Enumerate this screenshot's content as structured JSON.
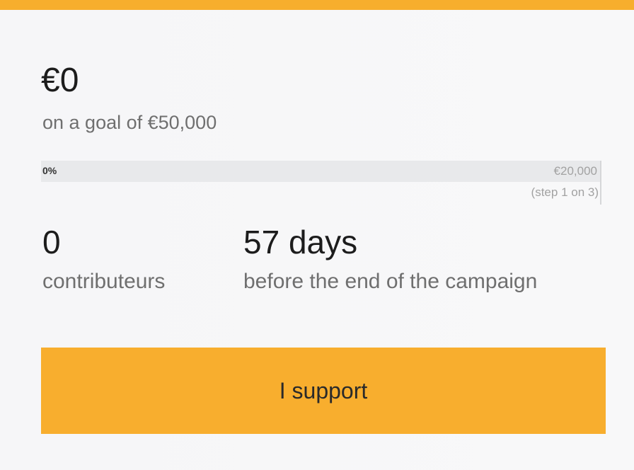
{
  "campaign": {
    "amount_raised": "€0",
    "goal_text": "on a goal of €50,000",
    "progress": {
      "percent_label": "0%",
      "fraction": 0,
      "step_target": "€20,000",
      "step_note": "(step 1 on 3)"
    },
    "stats": [
      {
        "value": "0",
        "label": "contributeurs"
      },
      {
        "value": "57 days",
        "label": "before the end of the campaign"
      }
    ],
    "support_button_label": "I support"
  },
  "colors": {
    "accent": "#f7ae2d",
    "track": "#e8e9eb",
    "muted_text": "#6f6f6f"
  }
}
